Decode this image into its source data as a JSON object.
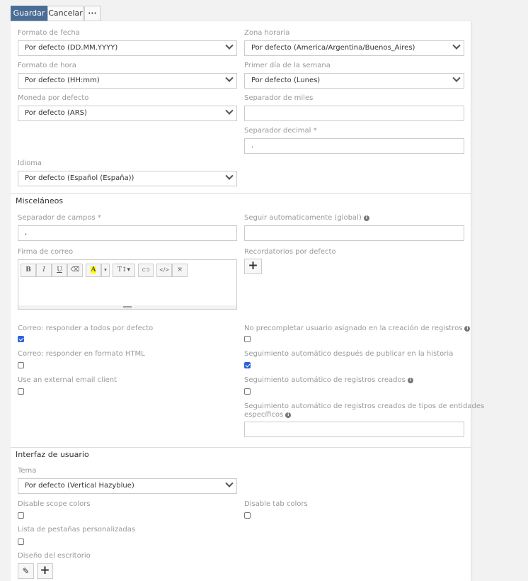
{
  "toolbar": {
    "save": "Guardar",
    "cancel": "Cancelar",
    "more": "•••"
  },
  "fields": {
    "date_format": {
      "label": "Formato de fecha",
      "value": "Por defecto (DD.MM.YYYY)"
    },
    "timezone": {
      "label": "Zona horaria",
      "value": "Por defecto (America/Argentina/Buenos_Aires)"
    },
    "time_format": {
      "label": "Formato de hora",
      "value": "Por defecto (HH:mm)"
    },
    "week_start": {
      "label": "Primer día de la semana",
      "value": "Por defecto (Lunes)"
    },
    "currency": {
      "label": "Moneda por defecto",
      "value": "Por defecto (ARS)"
    },
    "thousand_sep": {
      "label": "Separador de miles",
      "value": ""
    },
    "decimal_sep": {
      "label": "Separador decimal *",
      "value": "."
    },
    "language": {
      "label": "Idioma",
      "value": "Por defecto (Español (España))"
    }
  },
  "misc": {
    "title": "Misceláneos",
    "field_sep": {
      "label": "Separador de campos *",
      "value": ","
    },
    "follow_global": {
      "label": "Seguir automaticamente (global)",
      "value": ""
    },
    "signature": {
      "label": "Firma de correo"
    },
    "reminders": {
      "label": "Recordatorios por defecto",
      "add": "+"
    },
    "reply_all": {
      "label": "Correo: responder a todos por defecto",
      "checked": true
    },
    "no_prefill": {
      "label": "No precompletar usuario asignado en la creación de registros",
      "checked": false
    },
    "html_reply": {
      "label": "Correo: responder en formato HTML",
      "checked": false
    },
    "follow_after_post": {
      "label": "Seguimiento automático después de publicar en la historia",
      "checked": true
    },
    "external_client": {
      "label": "Use an external email client",
      "checked": false
    },
    "follow_created": {
      "label": "Seguimiento automático de registros creados",
      "checked": false
    },
    "follow_entity_types": {
      "label1": "Seguimiento automático de registros creados de tipos de entidades",
      "label2": "específicos",
      "value": ""
    }
  },
  "editor": {
    "bold": "B",
    "italic": "I",
    "underline": "U",
    "eraser": "⌫",
    "color": "A",
    "caret": "▾",
    "size": "T↕▾",
    "link": "⊂⊃",
    "code": "</>",
    "fullscreen": "⤧"
  },
  "ui": {
    "title": "Interfaz de usuario",
    "theme": {
      "label": "Tema",
      "value": "Por defecto (Vertical Hazyblue)"
    },
    "scope_colors": {
      "label": "Disable scope colors",
      "checked": false
    },
    "tab_colors": {
      "label": "Disable tab colors",
      "checked": false
    },
    "custom_tabs": {
      "label": "Lista de pestañas personalizadas",
      "checked": false
    },
    "dashboard": {
      "label": "Diseño del escritorio",
      "edit": "✎",
      "add": "+"
    }
  },
  "colors": {
    "primary": "#4a6d96",
    "check": "#2b62d9"
  }
}
